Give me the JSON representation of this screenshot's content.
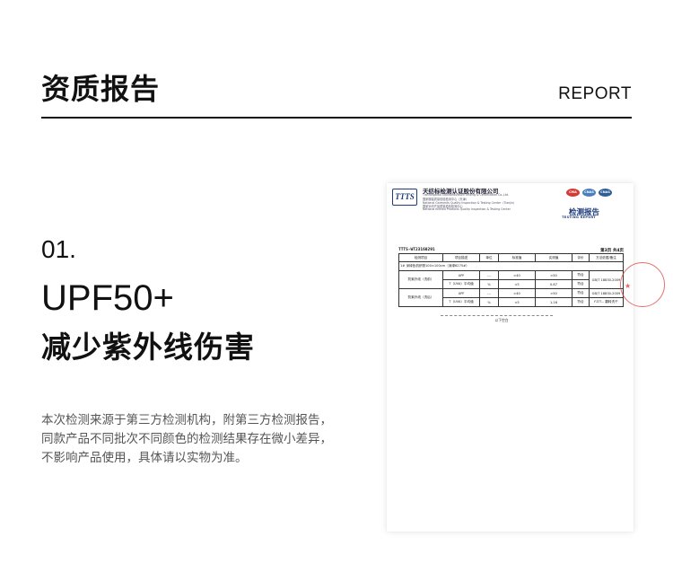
{
  "header": {
    "title": "资质报告",
    "subtitle_en": "REPORT"
  },
  "section": {
    "number": "01.",
    "headline": "UPF50+",
    "subheadline": "减少紫外线伤害",
    "description_lines": [
      "本次检测来源于第三方检测机构，附第三方检测报告，",
      "同款产品不同批次不同颜色的检测结果存在微小差异，",
      "不影响产品使用，具体请以实物为准。"
    ]
  },
  "report": {
    "logo_text": "TTTS",
    "org_name": "天纺标检测认证股份有限公司",
    "org_lines": [
      "Tianfangbiao Standardization Testing & Certification Co.,Ltd.",
      "国家服装质量检验检测中心（天津）",
      "National Garments Quality Inspection & Testing Center（Tianjin）",
      "国家针织产品质量检验检测中心",
      "National Knitted Products Quality Inspection & Testing Center"
    ],
    "cert_marks": [
      {
        "label": "CMA",
        "color": "#d63a35"
      },
      {
        "label": "CNAS",
        "color": "#4a7fbf"
      },
      {
        "label": "CNAS",
        "color": "#2f5d97"
      }
    ],
    "title": "检测报告",
    "title_en": "TESTING REPORT",
    "report_no": "TTTS-WT23160291",
    "page_info": "第3页 共4页",
    "table_headers": [
      "检测项目",
      "项目描述",
      "单位",
      "标准值",
      "实测值",
      "评价",
      "方法依据/备注"
    ],
    "color_row": "1#  深绿色机织物100×100cm（深绿6275#）",
    "rows": [
      {
        "item": "防紫外线（洗前）",
        "desc": "UPF",
        "unit": "---",
        "std": ">40",
        "measured": ">50",
        "eval": "符合",
        "method": ""
      },
      {
        "item": "",
        "desc": "T（UVA）平均值",
        "unit": "%",
        "std": "<5",
        "measured": "0.87",
        "eval": "符合",
        "method": "GB/T 18830-2009"
      },
      {
        "item": "防紫外线（洗后）",
        "desc": "UPF",
        "unit": "---",
        "std": ">40",
        "measured": ">50",
        "eval": "符合",
        "method": "GB/T 18830-2009"
      },
      {
        "item": "",
        "desc": "T（UVA）平均值",
        "unit": "%",
        "std": "<5",
        "measured": "1.16",
        "eval": "符合",
        "method": "FZ/T... 翻转洗干"
      }
    ],
    "end_text": "以下空白"
  }
}
